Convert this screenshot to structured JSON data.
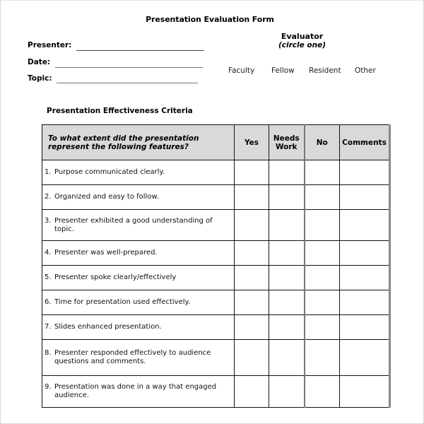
{
  "form": {
    "title": "Presentation Evaluation Form",
    "fields": [
      {
        "label": "Presenter:",
        "value": ""
      },
      {
        "label": "Date:",
        "value": ""
      },
      {
        "label": "Topic:",
        "value": ""
      }
    ],
    "evaluator": {
      "title": "Evaluator",
      "instruction": "(circle one)",
      "options": [
        "Faculty",
        "Fellow",
        "Resident",
        "Other"
      ]
    }
  },
  "criteria": {
    "section_title": "Presentation Effectiveness Criteria",
    "headers": {
      "question": "To what extent did the presentation represent the following features?",
      "yes": "Yes",
      "needs_work_line1": "Needs",
      "needs_work_line2": "Work",
      "no": "No",
      "comments": "Comments"
    },
    "items": [
      {
        "num": "1.",
        "text": "Purpose communicated clearly.",
        "yes": "",
        "needs_work": "",
        "no": "",
        "comments": ""
      },
      {
        "num": "2.",
        "text": "Organized and easy to follow.",
        "yes": "",
        "needs_work": "",
        "no": "",
        "comments": ""
      },
      {
        "num": "3.",
        "text": "Presenter exhibited a good understanding of topic.",
        "yes": "",
        "needs_work": "",
        "no": "",
        "comments": ""
      },
      {
        "num": "4.",
        "text": "Presenter was well-prepared.",
        "yes": "",
        "needs_work": "",
        "no": "",
        "comments": ""
      },
      {
        "num": "5.",
        "text": "Presenter spoke clearly/effectively",
        "yes": "",
        "needs_work": "",
        "no": "",
        "comments": ""
      },
      {
        "num": "6.",
        "text": "Time for presentation used effectively.",
        "yes": "",
        "needs_work": "",
        "no": "",
        "comments": ""
      },
      {
        "num": "7.",
        "text": "Slides enhanced presentation.",
        "yes": "",
        "needs_work": "",
        "no": "",
        "comments": ""
      },
      {
        "num": "8.",
        "text": "Presenter responded effectively to audience questions and comments.",
        "yes": "",
        "needs_work": "",
        "no": "",
        "comments": ""
      },
      {
        "num": "9.",
        "text": "Presentation was done in a way that engaged audience.",
        "yes": "",
        "needs_work": "",
        "no": "",
        "comments": ""
      }
    ]
  }
}
